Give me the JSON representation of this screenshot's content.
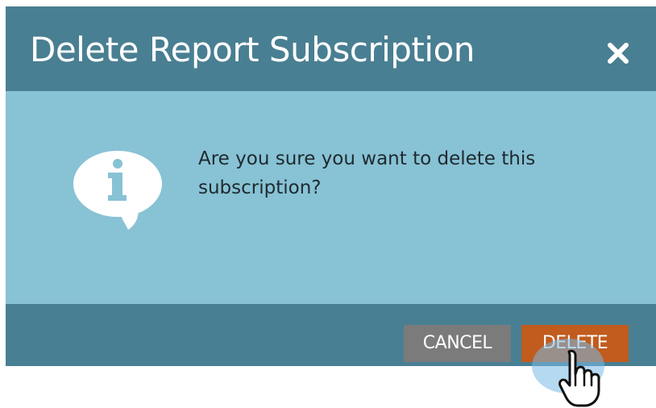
{
  "dialog": {
    "title": "Delete Report Subscription",
    "close_icon": "close-icon",
    "info_icon": "info-speech-bubble-icon",
    "message": "Are you sure you want to delete this subscription?",
    "cancel_label": "CANCEL",
    "delete_label": "DELETE"
  },
  "cursor": {
    "icon": "hand-pointer-icon"
  },
  "colors": {
    "header": "#497f92",
    "body": "#88c2d5",
    "cancel_button": "#7b7b7b",
    "delete_button": "#c15b1e"
  }
}
